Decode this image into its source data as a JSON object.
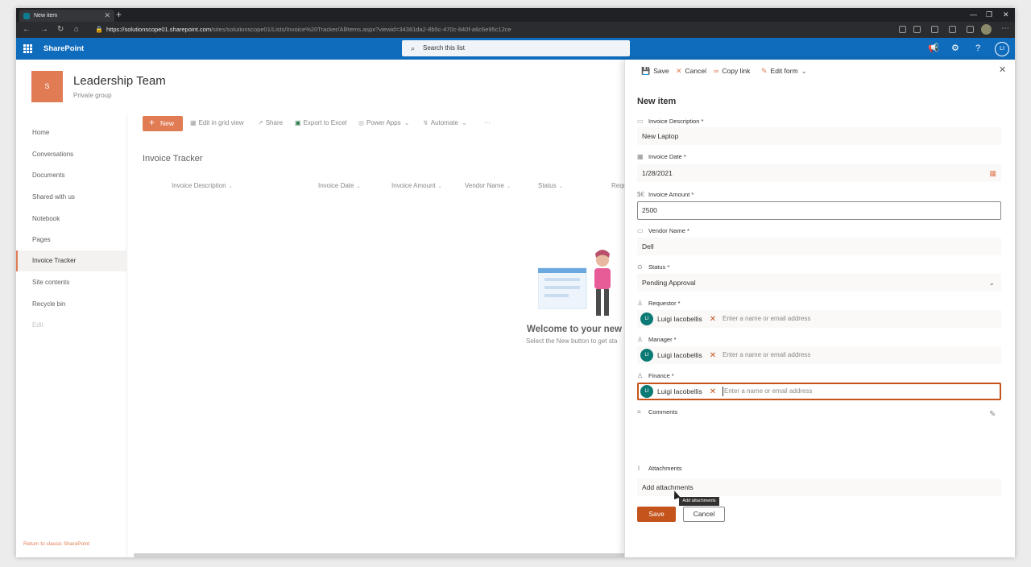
{
  "browser": {
    "tab_title": "New item",
    "url_host": "https://solutionscope01.sharepoint.com",
    "url_path": "/sites/solutionscope01/Lists/Invoice%20Tracker/AllItems.aspx?viewid=34381da2-8b5c-470c-840f-a6c6e95c12ce"
  },
  "suite": {
    "brand": "SharePoint",
    "search_placeholder": "Search this list",
    "user_initials": "LI"
  },
  "site": {
    "logo_letter": "S",
    "title": "Leadership Team",
    "subtitle": "Private group"
  },
  "nav": {
    "items": [
      "Home",
      "Conversations",
      "Documents",
      "Shared with us",
      "Notebook",
      "Pages",
      "Invoice Tracker",
      "Site contents",
      "Recycle bin",
      "Edit"
    ],
    "selected": "Invoice Tracker",
    "classic_link": "Return to classic SharePoint"
  },
  "commandbar": {
    "new": "New",
    "edit_grid": "Edit in grid view",
    "share": "Share",
    "export": "Export to Excel",
    "power_apps": "Power Apps",
    "automate": "Automate",
    "more": "···"
  },
  "list": {
    "title": "Invoice Tracker",
    "columns": [
      "Invoice Description",
      "Invoice Date",
      "Invoice Amount",
      "Vendor Name",
      "Status",
      "Requ"
    ],
    "empty_title": "Welcome to your new",
    "empty_sub": "Select the New button to get sta"
  },
  "panel": {
    "toolbar": {
      "save": "Save",
      "cancel": "Cancel",
      "copy_link": "Copy link",
      "edit_form": "Edit form"
    },
    "title": "New item",
    "fields": {
      "description": {
        "label": "Invoice Description *",
        "value": "New Laptop"
      },
      "date": {
        "label": "Invoice Date *",
        "value": "1/28/2021"
      },
      "amount": {
        "label": "Invoice Amount *",
        "value": "2500"
      },
      "vendor": {
        "label": "Vendor Name *",
        "value": "Dell"
      },
      "status": {
        "label": "Status *",
        "value": "Pending Approval"
      },
      "requestor": {
        "label": "Requestor *",
        "person": "Luigi Iacobellis",
        "initials": "LI",
        "placeholder": "Enter a name or email address"
      },
      "manager": {
        "label": "Manager *",
        "person": "Luigi Iacobellis",
        "initials": "LI",
        "placeholder": "Enter a name or email address"
      },
      "finance": {
        "label": "Finance *",
        "person": "Luigi Iacobellis",
        "initials": "LI",
        "placeholder": "Enter a name or email address"
      },
      "comments": {
        "label": "Comments"
      },
      "attachments": {
        "label": "Attachments",
        "add": "Add attachments",
        "tooltip": "Add attachments"
      }
    },
    "save_button": "Save",
    "cancel_button": "Cancel"
  },
  "colors": {
    "suite_bar": "#0f6cbd",
    "accent": "#e07b54",
    "save_button": "#c4541b",
    "persona": "#0b7a75"
  }
}
